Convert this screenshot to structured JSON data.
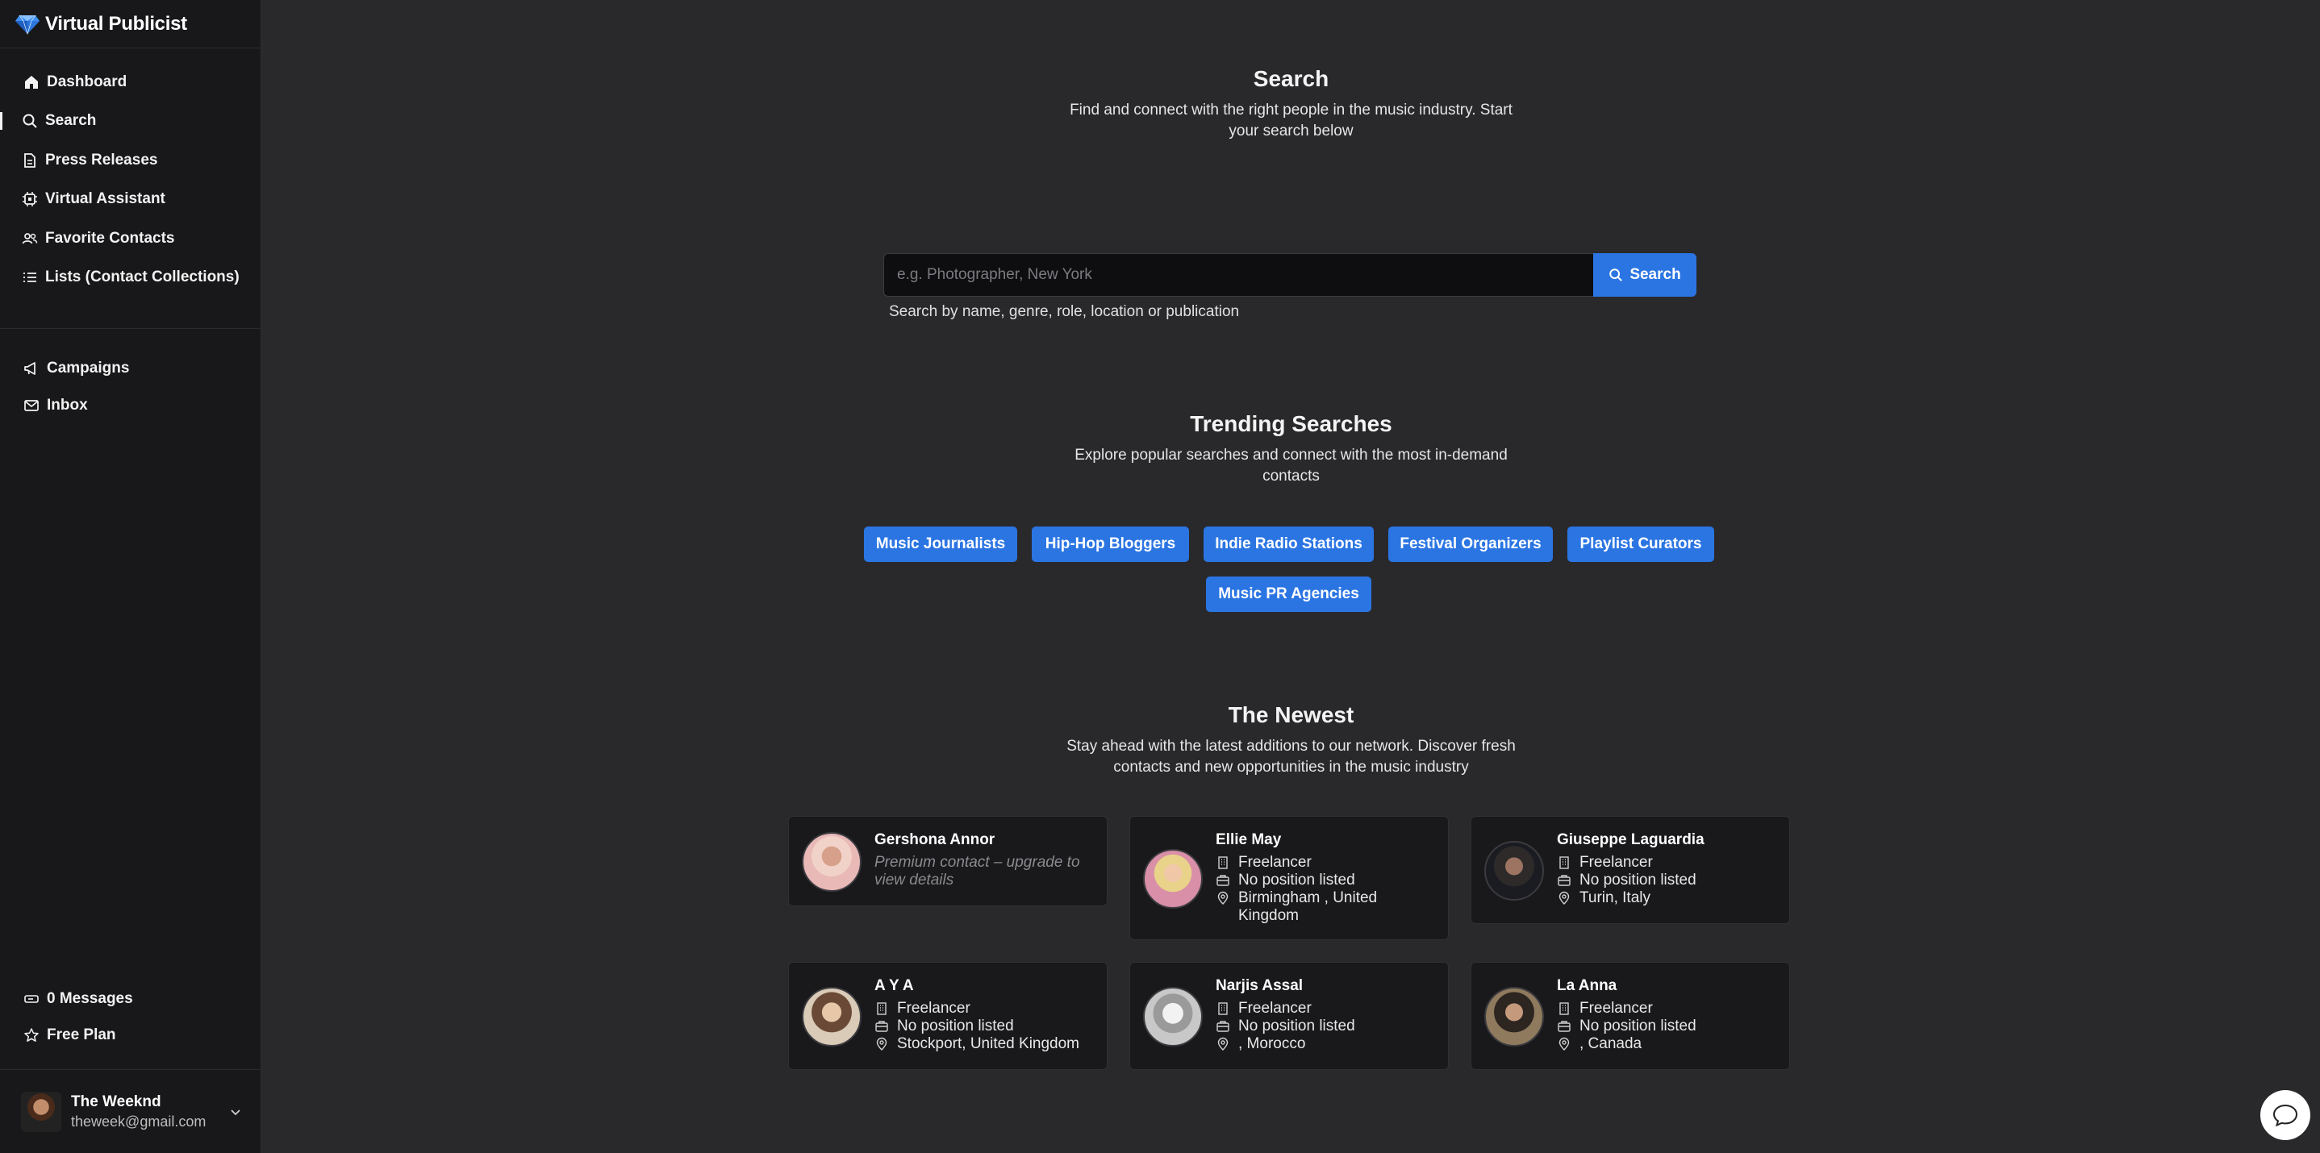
{
  "app": {
    "brand": "Virtual Publicist",
    "accent": "#2b75e3"
  },
  "sidebar": {
    "nav": [
      {
        "label": "Dashboard",
        "icon": "home-icon"
      },
      {
        "label": "Search",
        "icon": "search-icon",
        "active": true
      },
      {
        "label": "Press Releases",
        "icon": "document-icon"
      },
      {
        "label": "Virtual Assistant",
        "icon": "chip-icon"
      },
      {
        "label": "Favorite Contacts",
        "icon": "users-icon"
      },
      {
        "label": "Lists (Contact Collections)",
        "icon": "list-icon"
      }
    ],
    "nav2": [
      {
        "label": "Campaigns",
        "icon": "megaphone-icon"
      },
      {
        "label": "Inbox",
        "icon": "mail-icon"
      }
    ],
    "bottom": [
      {
        "label": "0 Messages",
        "icon": "ticket-icon"
      },
      {
        "label": "Free Plan",
        "icon": "star-icon"
      }
    ],
    "user": {
      "name": "The Weeknd",
      "email": "theweek@gmail.com"
    }
  },
  "search": {
    "title": "Search",
    "subtitle": "Find and connect with the right people in the music industry. Start your search below",
    "placeholder": "e.g. Photographer, New York",
    "button": "Search",
    "help": "Search by name, genre, role, location or publication"
  },
  "trending": {
    "title": "Trending Searches",
    "subtitle": "Explore popular searches and connect with the most in-demand contacts",
    "chips": [
      "Music Journalists",
      "Hip-Hop Bloggers",
      "Indie Radio Stations",
      "Festival Organizers",
      "Playlist Curators",
      "Music PR Agencies"
    ]
  },
  "newest": {
    "title": "The Newest",
    "subtitle": "Stay ahead with the latest additions to our network. Discover fresh contacts and new opportunities in the music industry",
    "contacts": [
      {
        "name": "Gershona Annor",
        "premium": "Premium contact – upgrade to view details"
      },
      {
        "name": "Ellie May",
        "type": "Freelancer",
        "position": "No position listed",
        "location": "Birmingham , United Kingdom"
      },
      {
        "name": "Giuseppe Laguardia",
        "type": "Freelancer",
        "position": "No position listed",
        "location": "Turin, Italy"
      },
      {
        "name": "A Y A",
        "type": "Freelancer",
        "position": "No position listed",
        "location": "Stockport, United Kingdom"
      },
      {
        "name": "Narjis Assal",
        "type": "Freelancer",
        "position": "No position listed",
        "location": ", Morocco"
      },
      {
        "name": "La Anna",
        "type": "Freelancer",
        "position": "No position listed",
        "location": ", Canada"
      }
    ]
  }
}
